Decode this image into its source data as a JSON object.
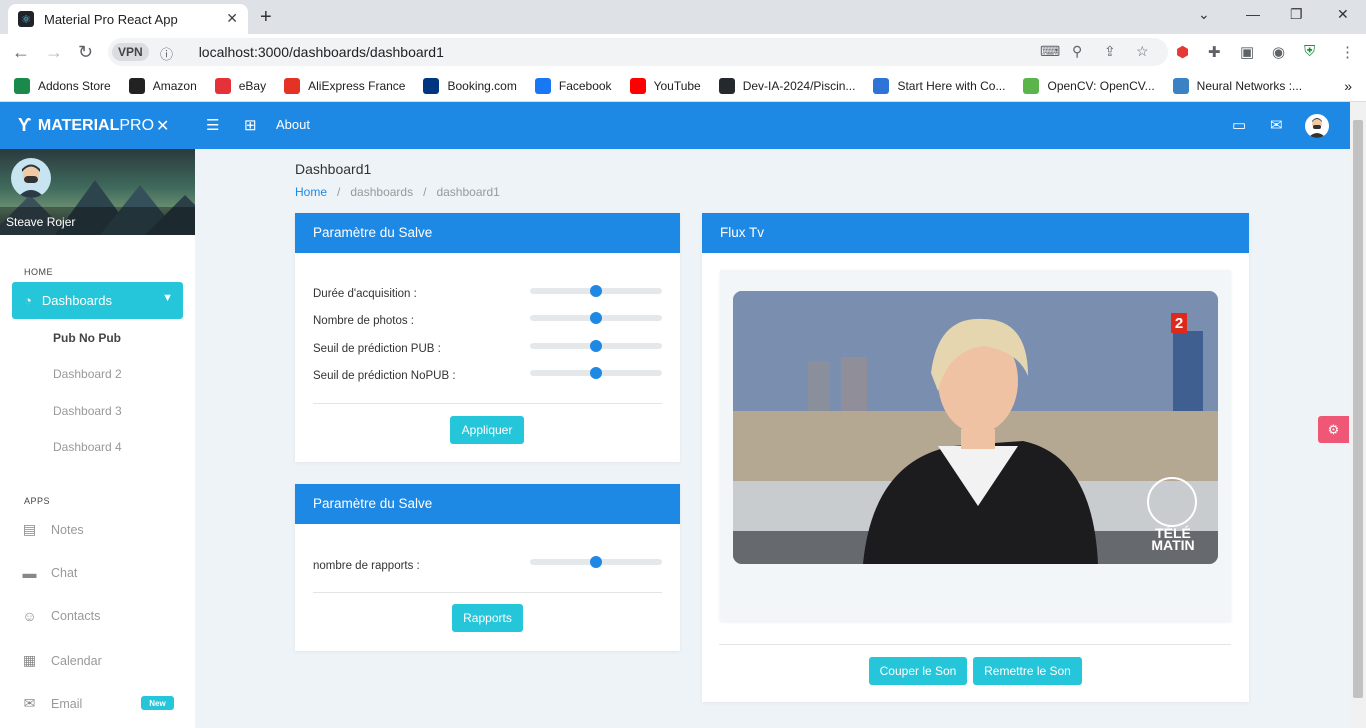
{
  "browser": {
    "tab_title": "Material Pro React App",
    "new_tab": "+",
    "url": "localhost:3000/dashboards/dashboard1",
    "vpn": "VPN",
    "bookmarks": [
      {
        "label": "Addons Store",
        "color": "#1a8a4a"
      },
      {
        "label": "Amazon",
        "color": "#222"
      },
      {
        "label": "eBay",
        "color": "#e53238"
      },
      {
        "label": "AliExpress France",
        "color": "#e43225"
      },
      {
        "label": "Booking.com",
        "color": "#003580"
      },
      {
        "label": "Facebook",
        "color": "#1877f2"
      },
      {
        "label": "YouTube",
        "color": "#ff0000"
      },
      {
        "label": "Dev-IA-2024/Piscin...",
        "color": "#24292e"
      },
      {
        "label": "Start Here with Co...",
        "color": "#2e73d6"
      },
      {
        "label": "OpenCV: OpenCV...",
        "color": "#5ab44b"
      },
      {
        "label": "Neural Networks :...",
        "color": "#3b82c4"
      }
    ],
    "more": "»"
  },
  "app": {
    "logo_main": "MATERIAL",
    "logo_pro": "PRO",
    "about": "About",
    "accent": "#1e88e5",
    "cyan": "#26c6da"
  },
  "sidebar": {
    "user": "Steave Rojer",
    "home_label": "HOME",
    "dashboards": "Dashboards",
    "subitems": [
      "Pub No Pub",
      "Dashboard 2",
      "Dashboard 3",
      "Dashboard 4"
    ],
    "apps_label": "APPS",
    "apps": [
      {
        "label": "Notes",
        "icon": "notes-icon"
      },
      {
        "label": "Chat",
        "icon": "chat-icon"
      },
      {
        "label": "Contacts",
        "icon": "contacts-icon"
      },
      {
        "label": "Calendar",
        "icon": "calendar-icon"
      },
      {
        "label": "Email",
        "icon": "email-icon"
      }
    ],
    "new_badge": "New"
  },
  "page": {
    "title": "Dashboard1",
    "breadcrumb": [
      "Home",
      "dashboards",
      "dashboard1"
    ]
  },
  "salve1": {
    "title": "Paramètre du Salve",
    "sliders": [
      {
        "label": "Durée d'acquisition :",
        "value": 0.5
      },
      {
        "label": "Nombre de photos :",
        "value": 0.5
      },
      {
        "label": "Seuil de prédiction PUB :",
        "value": 0.5
      },
      {
        "label": "Seuil de prédiction NoPUB :",
        "value": 0.5
      }
    ],
    "button": "Appliquer"
  },
  "salve2": {
    "title": "Paramètre du Salve",
    "sliders": [
      {
        "label": "nombre de rapports :",
        "value": 0.5
      }
    ],
    "button": "Rapports"
  },
  "flux": {
    "title": "Flux Tv",
    "channel": "2",
    "show_line1": "TÉLÉ",
    "show_line2": "MATIN",
    "mute": "Couper le Son",
    "unmute": "Remettre le Son"
  }
}
